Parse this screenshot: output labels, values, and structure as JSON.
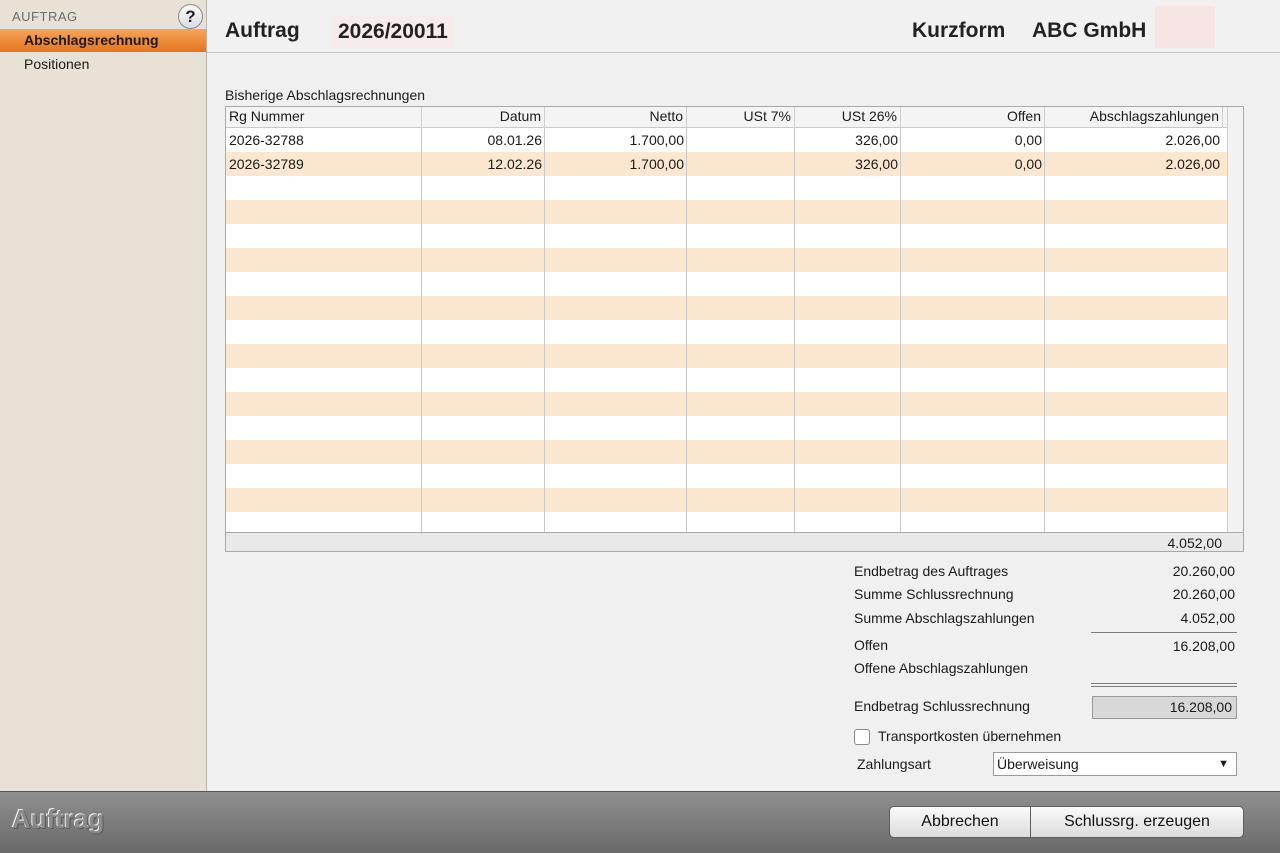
{
  "sidebar": {
    "section": "AUFTRAG",
    "help_glyph": "?",
    "items": [
      {
        "label": "Abschlagsrechnung"
      },
      {
        "label": "Positionen"
      }
    ]
  },
  "header": {
    "auftrag_label": "Auftrag",
    "auftrag_number": "2026/20011",
    "kurzform_label": "Kurzform",
    "kurzform_value": "ABC GmbH"
  },
  "table": {
    "title": "Bisherige Abschlagsrechnungen",
    "columns": [
      "Rg Nummer",
      "Datum",
      "Netto",
      "USt 7%",
      "USt 26%",
      "Offen",
      "Abschlagszahlungen"
    ],
    "rows": [
      [
        "2026-32788",
        "08.01.26",
        "1.700,00",
        "",
        "326,00",
        "0,00",
        "2.026,00"
      ],
      [
        "2026-32789",
        "12.02.26",
        "1.700,00",
        "",
        "326,00",
        "0,00",
        "2.026,00"
      ]
    ],
    "total": "4.052,00"
  },
  "summary": {
    "endbetrag_auftrag_label": "Endbetrag des Auftrages",
    "endbetrag_auftrag_value": "20.260,00",
    "summe_schluss_label": "Summe Schlussrechnung",
    "summe_schluss_value": "20.260,00",
    "summe_abschlag_label": "Summe Abschlagszahlungen",
    "summe_abschlag_value": "4.052,00",
    "offen_label": "Offen",
    "offen_value": "16.208,00",
    "offene_abschlag_label": "Offene Abschlagszahlungen",
    "endbetrag_schluss_label": "Endbetrag Schlussrechnung",
    "endbetrag_schluss_value": "16.208,00",
    "transport_label": "Transportkosten übernehmen",
    "zahlungsart_label": "Zahlungsart",
    "zahlungsart_value": "Überweisung"
  },
  "footer": {
    "title": "Auftrag",
    "cancel_label": "Abbrechen",
    "create_label": "Schlussrg. erzeugen"
  },
  "colors": {
    "accent": "#e6741d",
    "row_stripe": "#fbe6cf",
    "sidebar_bg": "#e8e2d6"
  }
}
